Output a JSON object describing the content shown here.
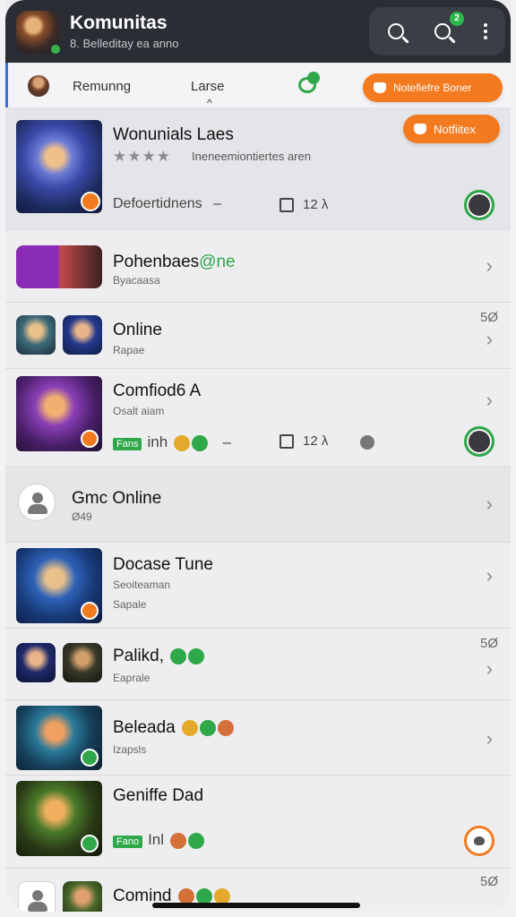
{
  "header": {
    "title": "Komunitas",
    "subtitle": "8. Belleditay ea anno",
    "search_badge": "2",
    "icons": {
      "search": "search-icon",
      "contacts": "search-contacts-icon",
      "more": "more-vertical-icon"
    }
  },
  "tabs": {
    "items": [
      {
        "label": "Remunng"
      },
      {
        "label": "Larse"
      }
    ],
    "active_caret": "^",
    "notify_button": "Notefiefre Boner"
  },
  "featured": {
    "title": "Wonunials Laes",
    "stars": "★★★★",
    "meta": "Ineneemiontiertes aren",
    "button": "Notfiitex",
    "desc": "Defoertidnens",
    "desc_suffix": "–",
    "likes": "12 λ"
  },
  "rows": [
    {
      "title": "Pohenbaes",
      "suffix": "@ne",
      "sub": "Byacaasa"
    },
    {
      "title": "Online",
      "sub": "Rapae",
      "count": "5Ø"
    },
    {
      "title": "Comfiod6 A",
      "sub": "Osalt aiam",
      "tag": "Fans",
      "tag_text": "inh",
      "dash": "–",
      "likes": "12 λ"
    },
    {
      "title": "Gmc Online",
      "sub": "Ø49"
    },
    {
      "title": "Docase Tune",
      "sub": "Seoiteaman",
      "sub2": "Sapale"
    },
    {
      "title": "Palikd,",
      "sub": "Eaprale",
      "count": "5Ø"
    },
    {
      "title": "Beleada",
      "sub": "Izapsls"
    },
    {
      "title": "Geniffe Dad",
      "tag": "Fano",
      "tag_text": "Inl"
    },
    {
      "title": "Comind",
      "count": "5Ø"
    }
  ],
  "colors": {
    "accent": "#f47a1f",
    "green": "#2fa84a",
    "header": "#2a2d33"
  }
}
